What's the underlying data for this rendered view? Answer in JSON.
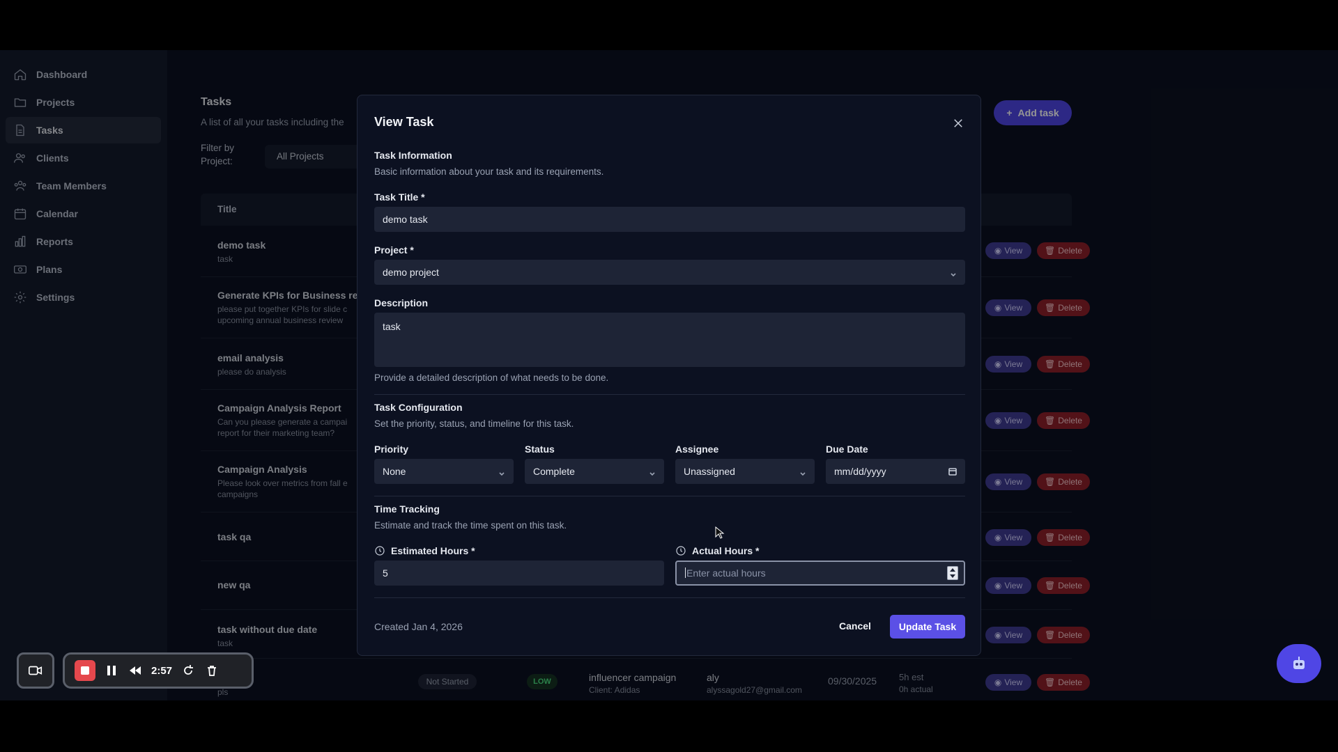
{
  "sidebar": {
    "items": [
      {
        "label": "Dashboard",
        "icon": "home-icon"
      },
      {
        "label": "Projects",
        "icon": "folder-icon"
      },
      {
        "label": "Tasks",
        "icon": "document-icon",
        "active": true
      },
      {
        "label": "Clients",
        "icon": "users-icon"
      },
      {
        "label": "Team Members",
        "icon": "team-icon"
      },
      {
        "label": "Calendar",
        "icon": "calendar-icon"
      },
      {
        "label": "Reports",
        "icon": "bar-chart-icon"
      },
      {
        "label": "Plans",
        "icon": "money-icon"
      },
      {
        "label": "Settings",
        "icon": "gear-icon"
      }
    ]
  },
  "page": {
    "title": "Tasks",
    "subtitle": "A list of all your tasks including the",
    "filter_label": "Filter by Project:",
    "filter_value": "All Projects",
    "add_task_label": "Add task",
    "column_title": "Title",
    "view_label": "View",
    "delete_label": "Delete",
    "rows": [
      {
        "title": "demo task",
        "desc": "task"
      },
      {
        "title": "Generate KPIs for Business rev",
        "desc": "please put together KPIs for slide c",
        "desc2": "upcoming annual business review"
      },
      {
        "title": "email analysis",
        "desc": "please do analysis"
      },
      {
        "title": "Campaign Analysis Report",
        "desc": "Can you please generate a campai",
        "desc2": "report for their marketing team?"
      },
      {
        "title": "Campaign Analysis",
        "desc": "Please look over metrics from fall e",
        "desc2": "campaigns"
      },
      {
        "title": "task qa",
        "desc": ""
      },
      {
        "title": "new qa",
        "desc": ""
      },
      {
        "title": "task without due date",
        "desc": "task"
      }
    ],
    "last_row": {
      "desc": "pls",
      "status": "Not Started",
      "priority": "LOW",
      "project": "influencer campaign",
      "client": "Client: Adidas",
      "assignee": "aly",
      "assignee_email": "alyssagold27@gmail.com",
      "due": "09/30/2025",
      "est": "5h est",
      "actual": "0h actual"
    }
  },
  "modal": {
    "title": "View Task",
    "info_heading": "Task Information",
    "info_sub": "Basic information about your task and its requirements.",
    "title_label": "Task Title *",
    "title_value": "demo task",
    "project_label": "Project *",
    "project_value": "demo project",
    "desc_label": "Description",
    "desc_value": "task",
    "desc_help": "Provide a detailed description of what needs to be done.",
    "config_heading": "Task Configuration",
    "config_sub": "Set the priority, status, and timeline for this task.",
    "priority_label": "Priority",
    "priority_value": "None",
    "status_label": "Status",
    "status_value": "Complete",
    "assignee_label": "Assignee",
    "assignee_value": "Unassigned",
    "due_label": "Due Date",
    "due_placeholder": "mm/dd/yyyy",
    "time_heading": "Time Tracking",
    "time_sub": "Estimate and track the time spent on this task.",
    "est_label": "Estimated Hours *",
    "est_value": "5",
    "actual_label": "Actual Hours *",
    "actual_placeholder": "Enter actual hours",
    "created": "Created Jan 4, 2026",
    "cancel_label": "Cancel",
    "update_label": "Update Task"
  },
  "recorder": {
    "time": "2:57"
  },
  "colors": {
    "accent": "#4f46e5",
    "danger": "#8e1f2a",
    "background": "#0c1121"
  }
}
